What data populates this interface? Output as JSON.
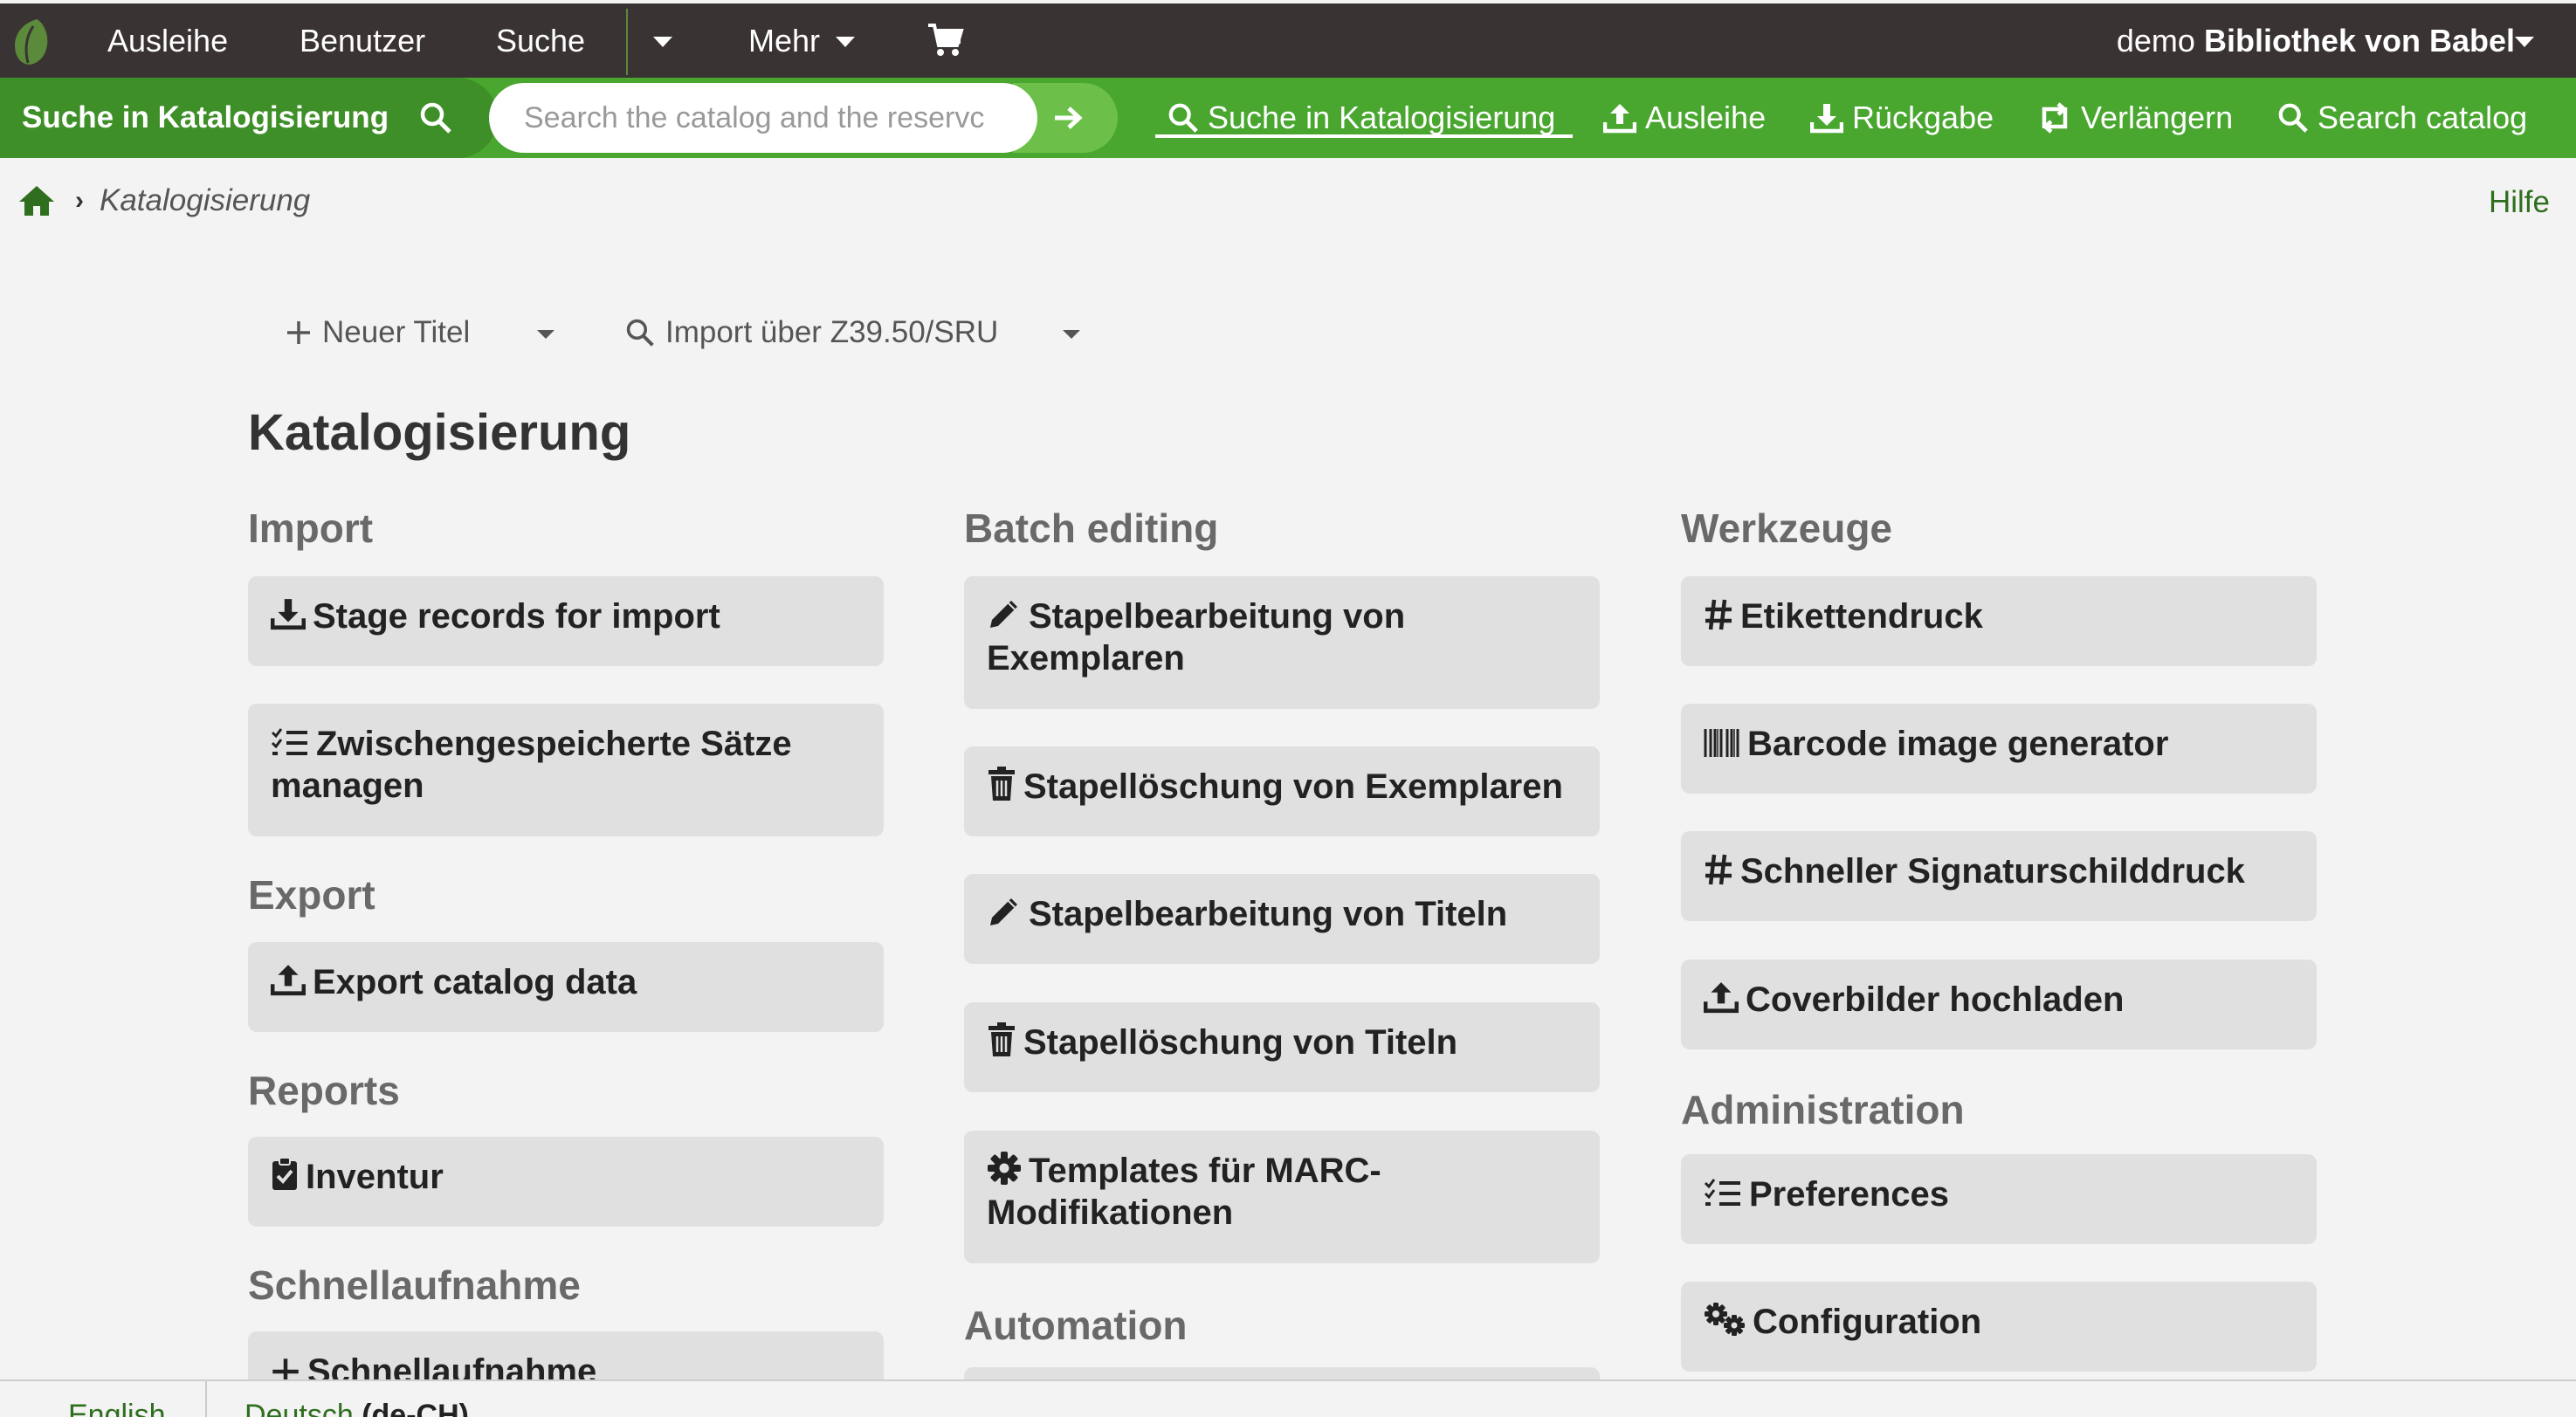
{
  "topnav": {
    "items": [
      "Ausleihe",
      "Benutzer",
      "Suche"
    ],
    "more_label": "Mehr",
    "user_prefix": "demo",
    "library": "Bibliothek von Babel"
  },
  "searchbar": {
    "label": "Suche in Katalogisierung",
    "placeholder": "Search the catalog and the reservc",
    "quick_links": [
      "Suche in Katalogisierung",
      "Ausleihe",
      "Rückgabe",
      "Verlängern",
      "Search catalog"
    ]
  },
  "breadcrumb": {
    "current": "Katalogisierung"
  },
  "help_label": "Hilfe",
  "toolbar": {
    "new_record": "Neuer Titel",
    "z3950": "Import über Z39.50/SRU"
  },
  "page_title": "Katalogisierung",
  "sections": {
    "import": {
      "title": "Import",
      "items": [
        "Stage records for import",
        "Zwischengespeicherte Sätze managen"
      ]
    },
    "export": {
      "title": "Export",
      "items": [
        "Export catalog data"
      ]
    },
    "reports": {
      "title": "Reports",
      "items": [
        "Inventur"
      ]
    },
    "quick": {
      "title": "Schnellaufnahme",
      "items": [
        "Schnellaufnahme"
      ]
    },
    "batch": {
      "title": "Batch editing",
      "items": [
        "Stapelbearbeitung von Exemplaren",
        "Stapellöschung von Exemplaren",
        "Stapelbearbeitung von Titeln",
        "Stapellöschung von Titeln",
        "Templates für MARC-Modifikationen"
      ]
    },
    "automation": {
      "title": "Automation"
    },
    "tools": {
      "title": "Werkzeuge",
      "items": [
        "Etikettendruck",
        "Barcode image generator",
        "Schneller Signaturschilddruck",
        "Coverbilder hochladen"
      ]
    },
    "admin": {
      "title": "Administration",
      "items": [
        "Preferences",
        "Configuration"
      ]
    }
  },
  "footer": {
    "lang_en": "English",
    "lang_de": "Deutsch",
    "lang_de_code": "(de-CH)"
  },
  "colors": {
    "dark_bar": "#3a3333",
    "green": "#49a62f",
    "green_dark": "#3f8f28",
    "tile": "#e0e0e0",
    "link": "#2f6e1e"
  }
}
